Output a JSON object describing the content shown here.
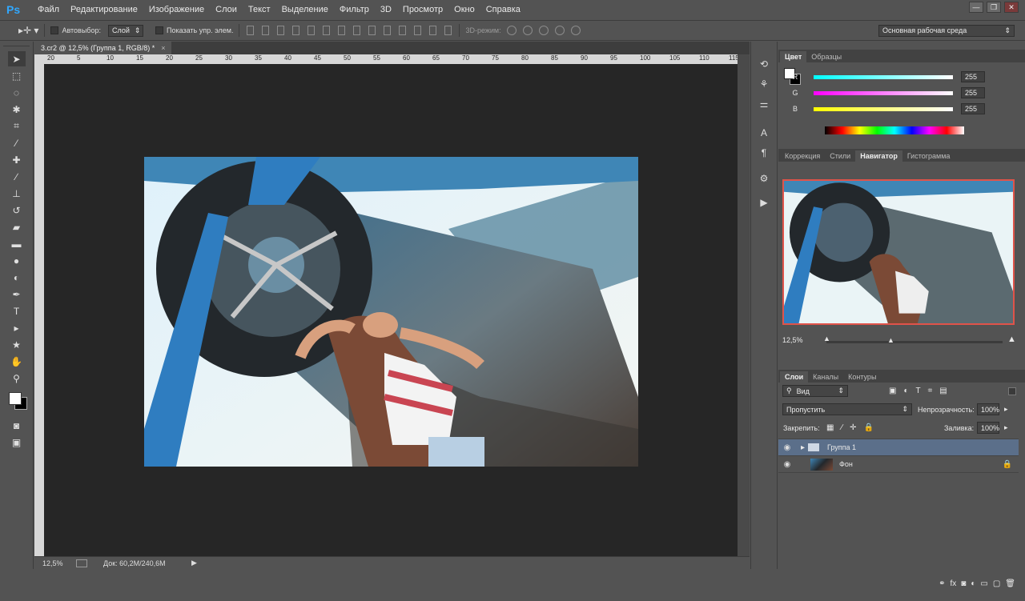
{
  "app": {
    "logo": "Ps",
    "accent": "#31a8ff"
  },
  "menu": [
    "Файл",
    "Редактирование",
    "Изображение",
    "Слои",
    "Текст",
    "Выделение",
    "Фильтр",
    "3D",
    "Просмотр",
    "Окно",
    "Справка"
  ],
  "window_buttons": [
    "—",
    "❐",
    "✕"
  ],
  "options": {
    "autoselect_label": "Автовыбор:",
    "autoselect_value": "Слой",
    "show_controls_label": "Показать упр. элем.",
    "mode3d_label": "3D-режим:",
    "workspace": "Основная рабочая среда"
  },
  "tools": [
    {
      "name": "move",
      "glyph": "➤"
    },
    {
      "name": "marquee",
      "glyph": "⬚"
    },
    {
      "name": "lasso",
      "glyph": "◌"
    },
    {
      "name": "quick-select",
      "glyph": "✱"
    },
    {
      "name": "crop",
      "glyph": "⌗"
    },
    {
      "name": "eyedropper",
      "glyph": "⁄"
    },
    {
      "name": "healing",
      "glyph": "✚"
    },
    {
      "name": "brush",
      "glyph": "∕"
    },
    {
      "name": "stamp",
      "glyph": "⊥"
    },
    {
      "name": "history-brush",
      "glyph": "↺"
    },
    {
      "name": "eraser",
      "glyph": "▰"
    },
    {
      "name": "gradient",
      "glyph": "▬"
    },
    {
      "name": "blur",
      "glyph": "●"
    },
    {
      "name": "dodge",
      "glyph": "◐"
    },
    {
      "name": "pen",
      "glyph": "✒"
    },
    {
      "name": "type",
      "glyph": "T"
    },
    {
      "name": "path-select",
      "glyph": "▸"
    },
    {
      "name": "shape",
      "glyph": "★"
    },
    {
      "name": "hand",
      "glyph": "✋"
    },
    {
      "name": "zoom",
      "glyph": "⚲"
    }
  ],
  "document": {
    "tab_title": "3.cr2 @ 12,5% (Группа 1, RGB/8) *",
    "ruler_labels": [
      "20",
      "5",
      "10",
      "15",
      "20",
      "25",
      "30",
      "35",
      "40",
      "45",
      "50",
      "55",
      "60",
      "65",
      "70",
      "75",
      "80",
      "85",
      "90",
      "95",
      "100",
      "105",
      "110",
      "115"
    ],
    "zoom": "12,5%",
    "doc_info": "Док: 60,2M/240,6M"
  },
  "color_panel": {
    "tabs": [
      "Цвет",
      "Образцы"
    ],
    "channels": [
      {
        "label": "R",
        "value": "255"
      },
      {
        "label": "G",
        "value": "255"
      },
      {
        "label": "B",
        "value": "255"
      }
    ]
  },
  "nav_panel": {
    "tabs": [
      "Коррекция",
      "Стили",
      "Навигатор",
      "Гистограмма"
    ],
    "zoom": "12,5%"
  },
  "layers_panel": {
    "tabs": [
      "Слои",
      "Каналы",
      "Контуры"
    ],
    "kind": "Вид",
    "blend_mode": "Пропустить",
    "opacity_label": "Непрозрачность:",
    "opacity": "100%",
    "lock_label": "Закрепить:",
    "fill_label": "Заливка:",
    "fill": "100%",
    "layers": [
      {
        "name": "Группа 1",
        "type": "group",
        "selected": true
      },
      {
        "name": "Фон",
        "type": "background",
        "selected": false
      }
    ]
  }
}
